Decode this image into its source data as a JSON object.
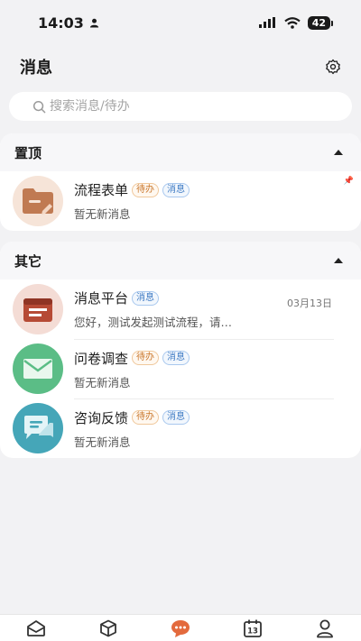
{
  "status_bar": {
    "time": "14:03",
    "battery": "42"
  },
  "header": {
    "title": "消息"
  },
  "search": {
    "placeholder": "搜索消息/待办"
  },
  "sections": [
    {
      "title": "置顶",
      "items": [
        {
          "name": "流程表单",
          "tags": [
            "待办",
            "消息"
          ],
          "subtitle": "暂无新消息",
          "icon": "folder-edit-icon",
          "color": "#c9815a"
        }
      ]
    },
    {
      "title": "其它",
      "items": [
        {
          "name": "消息平台",
          "tags": [
            "消息"
          ],
          "subtitle": "您好，测试发起测试流程，请…",
          "date": "03月13日",
          "icon": "message-platform-icon",
          "color": "#b64a35"
        },
        {
          "name": "问卷调查",
          "tags": [
            "待办",
            "消息"
          ],
          "subtitle": "暂无新消息",
          "icon": "envelope-icon",
          "color": "#5bbd86"
        },
        {
          "name": "咨询反馈",
          "tags": [
            "待办",
            "消息"
          ],
          "subtitle": "暂无新消息",
          "icon": "chat-bubble-icon",
          "color": "#45a6b8"
        }
      ]
    }
  ],
  "tabbar": {
    "tabs": [
      "inbox-icon",
      "cube-icon",
      "chat-dots-icon",
      "calendar-icon",
      "user-icon"
    ],
    "calendar_day": "13",
    "active_color": "#e36a3d"
  }
}
